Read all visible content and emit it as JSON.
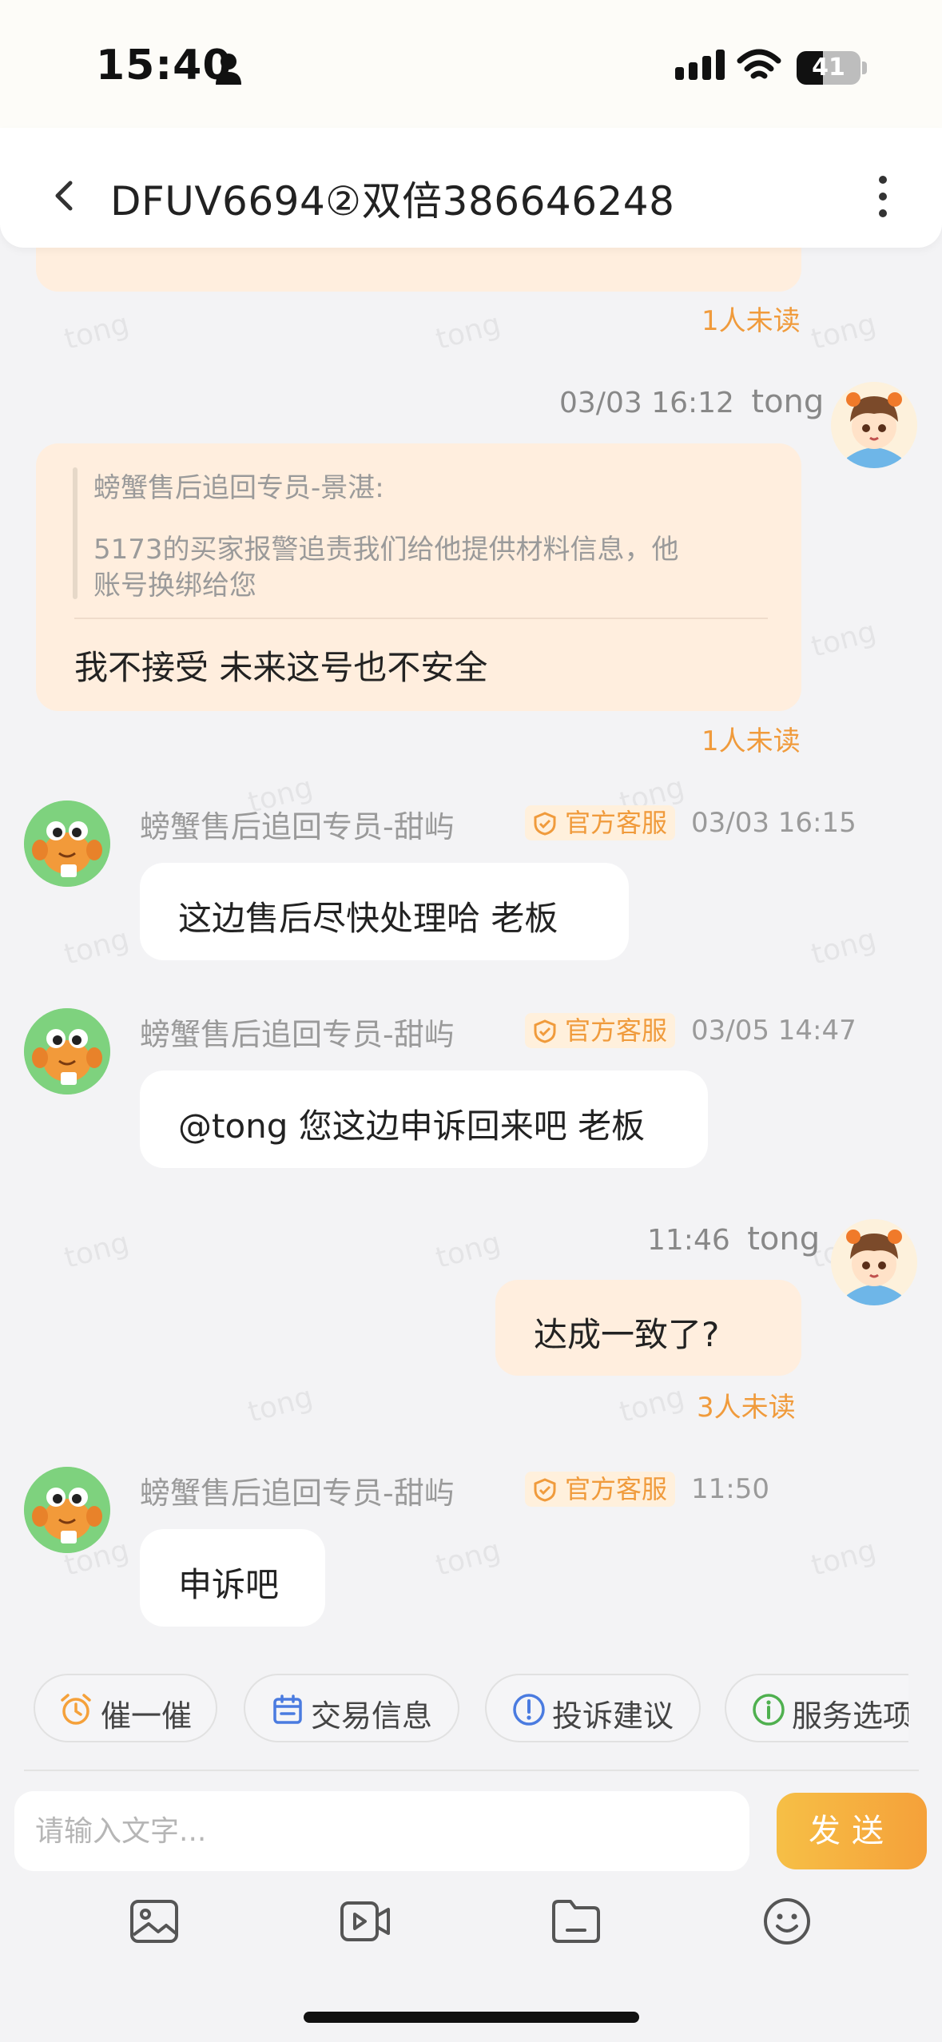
{
  "status_bar": {
    "time": "15:40",
    "battery": "41"
  },
  "header": {
    "title": "DFUV6694②双倍386646248"
  },
  "watermark_text": "tong",
  "messages": [
    {
      "unread": "1人未读"
    },
    {
      "time": "03/03 16:12",
      "sender": "tong",
      "quote_author": "螃蟹售后追回专员-景湛:",
      "quote_text_line1": "5173的买家报警追责我们给他提供材料信息，他",
      "quote_text_line2": "账号换绑给您",
      "text": "我不接受 未来这号也不安全",
      "unread": "1人未读"
    },
    {
      "sender": "螃蟹售后追回专员-甜屿",
      "badge": "官方客服",
      "time": "03/03 16:15",
      "text": "这边售后尽快处理哈 老板"
    },
    {
      "sender": "螃蟹售后追回专员-甜屿",
      "badge": "官方客服",
      "time": "03/05 14:47",
      "text": "@tong 您这边申诉回来吧 老板"
    },
    {
      "time": "11:46",
      "sender": "tong",
      "text": "达成一致了?",
      "unread": "3人未读"
    },
    {
      "sender": "螃蟹售后追回专员-甜屿",
      "badge": "官方客服",
      "time": "11:50",
      "text": "申诉吧"
    }
  ],
  "quick_actions": [
    "催一催",
    "交易信息",
    "投诉建议",
    "服务选项"
  ],
  "input": {
    "placeholder": "请输入文字..."
  },
  "send_label": "发送",
  "toolbar_icons": [
    "image-icon",
    "video-icon",
    "folder-icon",
    "emoji-icon"
  ],
  "colors": {
    "accent": "#f5a13a",
    "mine_bubble": "#ffeede",
    "unread": "#f09b3c",
    "badge_bg": "#fff0dc"
  }
}
